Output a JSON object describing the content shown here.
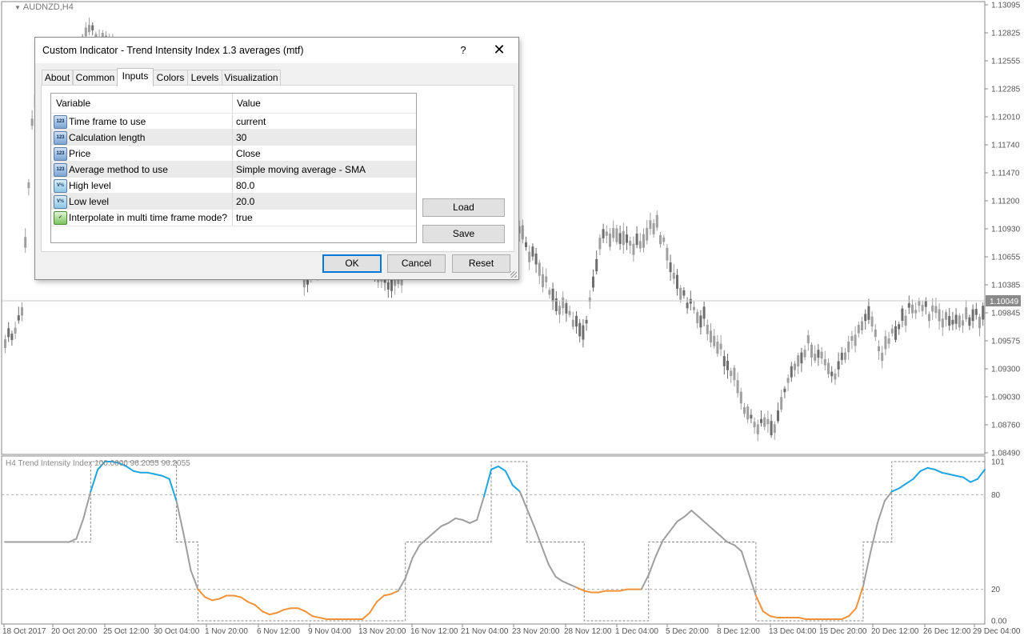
{
  "chart": {
    "symbol_label": "AUDNZD,H4",
    "price_ticks": [
      "1.13095",
      "1.12825",
      "1.12555",
      "1.12285",
      "1.12010",
      "1.11740",
      "1.11470",
      "1.11200",
      "1.10930",
      "1.10655",
      "1.10385",
      "1.09845",
      "1.09575",
      "1.09300",
      "1.09030",
      "1.08760",
      "1.08490"
    ],
    "current_price": "1.10049",
    "time_ticks": [
      "18 Oct 2017",
      "20 Oct 20:00",
      "25 Oct 12:00",
      "30 Oct 04:00",
      "1 Nov 20:00",
      "6 Nov 12:00",
      "9 Nov 04:00",
      "13 Nov 20:00",
      "16 Nov 12:00",
      "21 Nov 04:00",
      "23 Nov 20:00",
      "28 Nov 12:00",
      "1 Dec 04:00",
      "5 Dec 20:00",
      "8 Dec 12:00",
      "13 Dec 04:00",
      "15 Dec 20:00",
      "20 Dec 12:00",
      "26 Dec 12:00",
      "29 Dec 04:00"
    ],
    "colors": {
      "candle": "#a0a0a0",
      "candle_dark": "#6e6e6e",
      "tii_neutral": "#9e9e9e",
      "tii_up": "#1ea5e0",
      "tii_down": "#f0923a",
      "level_line": "#b0b0b0"
    }
  },
  "indicator": {
    "subtitle": "H4 Trend Intensity Index 100.0000 96.2055 96.2055",
    "scale_ticks": [
      "101",
      "80",
      "20",
      "0.00"
    ],
    "high_level": 80,
    "low_level": 20
  },
  "chart_data": {
    "type": "line",
    "title": "H4 Trend Intensity Index",
    "ylim": [
      0,
      101
    ],
    "series": [
      {
        "name": "Trend Intensity Index",
        "values": [
          50,
          50,
          50,
          50,
          50,
          50,
          50,
          50,
          50,
          50,
          52,
          65,
          82,
          96,
          101,
          101,
          100,
          98,
          95,
          94,
          94,
          93,
          92,
          90,
          76,
          55,
          32,
          20,
          15,
          13,
          14,
          16,
          16,
          15,
          12,
          10,
          6,
          4,
          5,
          7,
          8,
          8,
          6,
          3,
          2,
          1,
          1,
          1,
          1,
          1,
          1,
          5,
          12,
          16,
          17,
          19,
          27,
          40,
          48,
          52,
          56,
          60,
          62,
          65,
          64,
          62,
          64,
          79,
          96,
          98,
          95,
          86,
          82,
          71,
          60,
          48,
          36,
          28,
          25,
          23,
          21,
          19,
          18,
          18,
          19,
          19,
          19,
          20,
          20,
          20,
          29,
          41,
          51,
          57,
          63,
          66,
          70,
          66,
          62,
          58,
          54,
          50,
          48,
          44,
          30,
          16,
          6,
          3,
          2,
          2,
          2,
          2,
          1,
          1,
          1,
          1,
          1,
          1,
          3,
          8,
          22,
          43,
          62,
          76,
          82,
          84,
          87,
          90,
          95,
          97,
          96,
          94,
          93,
          92,
          91,
          88,
          90,
          96
        ]
      }
    ]
  },
  "dialog": {
    "title": "Custom Indicator - Trend Intensity Index 1.3 averages (mtf)",
    "help_label": "?",
    "close_label": "✕",
    "tabs": [
      "About",
      "Common",
      "Inputs",
      "Colors",
      "Levels",
      "Visualization"
    ],
    "active_tab": "Inputs",
    "columns": [
      "Variable",
      "Value"
    ],
    "inputs": [
      {
        "variable": "Time frame to use",
        "value": "current",
        "icon": "123"
      },
      {
        "variable": "Calculation length",
        "value": "30",
        "icon": "123"
      },
      {
        "variable": "Price",
        "value": "Close",
        "icon": "123"
      },
      {
        "variable": "Average method to use",
        "value": "Simple moving average - SMA",
        "icon": "123"
      },
      {
        "variable": "High level",
        "value": "80.0",
        "icon": "V½"
      },
      {
        "variable": "Low level",
        "value": "20.0",
        "icon": "V½"
      },
      {
        "variable": "Interpolate in multi time frame mode?",
        "value": "true",
        "icon": "bool"
      }
    ],
    "load_label": "Load",
    "save_label": "Save",
    "ok_label": "OK",
    "cancel_label": "Cancel",
    "reset_label": "Reset"
  }
}
